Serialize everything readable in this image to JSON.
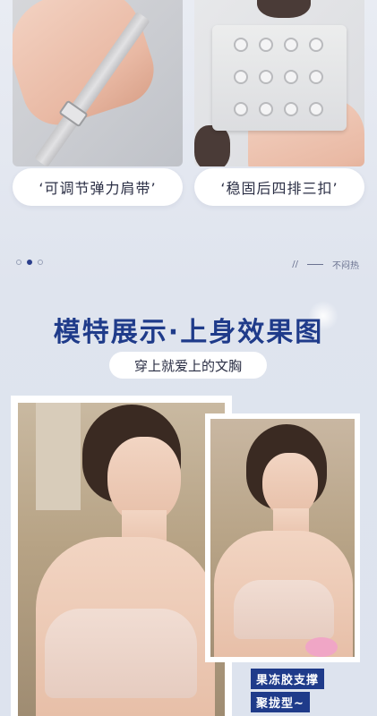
{
  "features": [
    {
      "label": "‘可调节弹力肩带’",
      "icon": "adjustable-strap-photo"
    },
    {
      "label": "‘稳固后四排三扣’",
      "icon": "hook-and-eye-photo"
    }
  ],
  "divider": {
    "tagline": "不闷热"
  },
  "section": {
    "title": "模特展示·上身效果图",
    "subtitle": "穿上就爱上的文胸"
  },
  "captions": [
    "果冻胶支撑",
    "聚拢型~"
  ],
  "colors": {
    "accent": "#1f3b8a",
    "background": "#e9ecf3"
  }
}
